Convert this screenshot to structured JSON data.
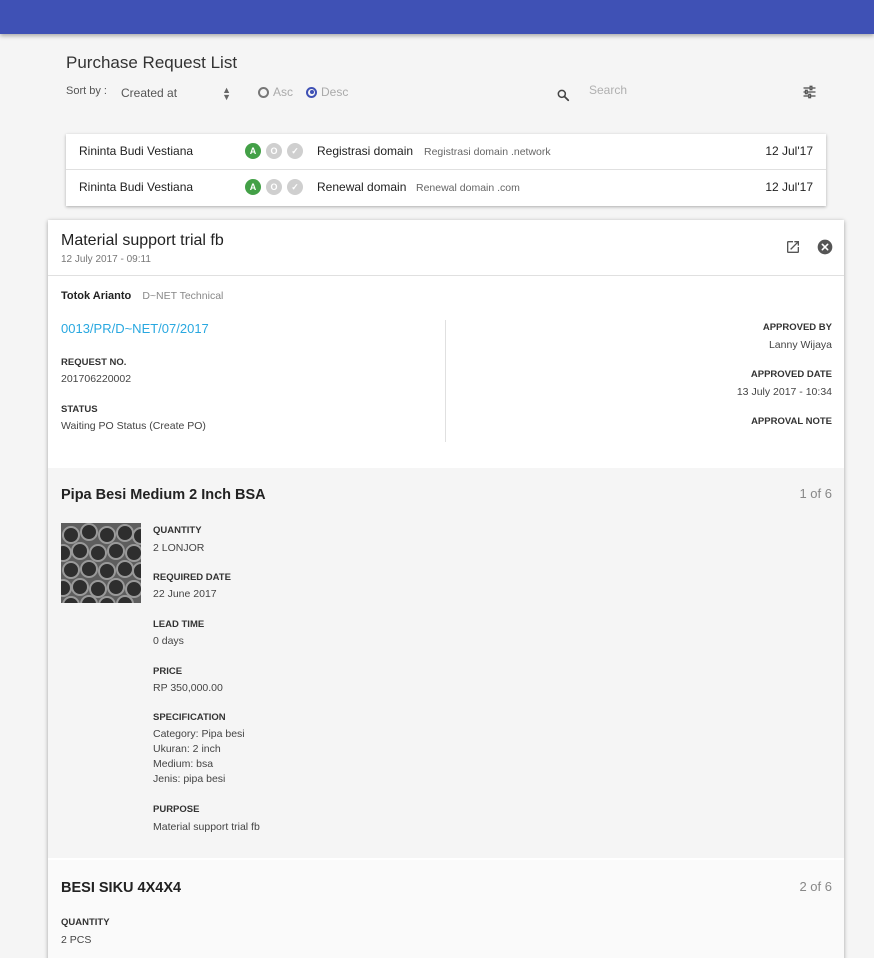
{
  "header": {
    "title": "Purchase Request List"
  },
  "sort": {
    "label": "Sort by :",
    "selected": "Created at",
    "asc_label": "Asc",
    "desc_label": "Desc",
    "selected_order": "Desc"
  },
  "search": {
    "placeholder": "Search"
  },
  "requests": [
    {
      "requester": "Rininta Budi Vestiana",
      "badges": [
        "A",
        "O",
        "✓"
      ],
      "title": "Registrasi domain",
      "subtitle": "Registrasi domain .network",
      "date": "12 Jul'17"
    },
    {
      "requester": "Rininta Budi Vestiana",
      "badges": [
        "A",
        "O",
        "✓"
      ],
      "title": "Renewal domain",
      "subtitle": "Renewal domain .com",
      "date": "12 Jul'17"
    }
  ],
  "detail": {
    "title": "Material support trial fb",
    "datetime": "12 July 2017 - 09:11",
    "requester": "Totok Arianto",
    "department": "D~NET Technical",
    "pr_number": "0013/PR/D~NET/07/2017",
    "request_no_label": "REQUEST NO.",
    "request_no": "201706220002",
    "status_label": "STATUS",
    "status": "Waiting PO Status (Create PO)",
    "approved_by_label": "APPROVED BY",
    "approved_by": "Lanny Wijaya",
    "approved_date_label": "APPROVED DATE",
    "approved_date": "13 July 2017 - 10:34",
    "approval_note_label": "APPROVAL NOTE",
    "items": [
      {
        "name": "Pipa Besi Medium 2 Inch BSA",
        "count": "1 of 6",
        "quantity_label": "QUANTITY",
        "quantity": "2 LONJOR",
        "required_date_label": "REQUIRED DATE",
        "required_date": "22 June 2017",
        "lead_time_label": "LEAD TIME",
        "lead_time": "0 days",
        "price_label": "PRICE",
        "price": "RP 350,000.00",
        "specification_label": "SPECIFICATION",
        "specification": [
          "Category:  Pipa besi",
          "Ukuran:  2 inch",
          "Medium:  bsa",
          "Jenis:  pipa besi"
        ],
        "purpose_label": "PURPOSE",
        "purpose": "Material support trial fb"
      },
      {
        "name": "BESI SIKU 4X4X4",
        "count": "2 of 6",
        "quantity_label": "QUANTITY",
        "quantity": "2 PCS"
      }
    ]
  },
  "colors": {
    "topbar": "#3f51b5",
    "link": "#29a8e0",
    "approved_badge": "#43a047"
  }
}
